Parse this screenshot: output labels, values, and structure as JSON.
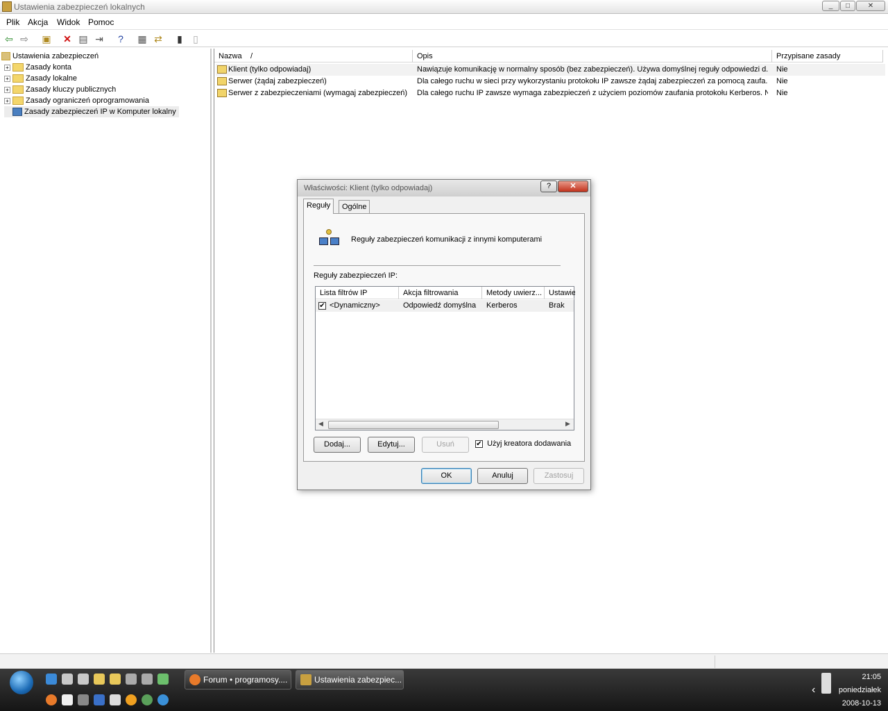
{
  "window": {
    "title": "Ustawienia zabezpieczeń lokalnych",
    "minimize": "_",
    "restore": "□",
    "close": "✕"
  },
  "menu": [
    "Plik",
    "Akcja",
    "Widok",
    "Pomoc"
  ],
  "toolbar": [
    "back-arrow-icon",
    "forward-arrow-icon",
    "up-folder-icon",
    "delete-icon",
    "properties-icon",
    "export-icon",
    "help-icon",
    "assign-icon",
    "policy-icon",
    "new-policy-icon",
    "edit-policy-icon"
  ],
  "tree": {
    "root": "Ustawienia zabezpieczeń",
    "items": [
      {
        "label": "Zasady konta",
        "expand": "+"
      },
      {
        "label": "Zasady lokalne",
        "expand": "+"
      },
      {
        "label": "Zasady kluczy publicznych",
        "expand": "+"
      },
      {
        "label": "Zasady ograniczeń oprogramowania",
        "expand": "+"
      },
      {
        "label": "Zasady zabezpieczeń IP w Komputer lokalny",
        "expand": ""
      }
    ]
  },
  "list": {
    "columns": [
      "Nazwa",
      "Opis",
      "Przypisane zasady"
    ],
    "sort_indicator": "/",
    "rows": [
      {
        "name": "Klient (tylko odpowiadaj)",
        "desc": "Nawiązuje komunikację w normalny sposób (bez zabezpieczeń). Używa domyślnej reguły odpowiedzi d...",
        "assigned": "Nie"
      },
      {
        "name": "Serwer (żądaj zabezpieczeń)",
        "desc": "Dla całego ruchu w sieci przy wykorzystaniu protokołu IP zawsze żądaj zabezpieczeń za pomocą zaufa...",
        "assigned": "Nie"
      },
      {
        "name": "Serwer z zabezpieczeniami (wymagaj zabezpieczeń)",
        "desc": "Dla całego ruchu IP zawsze wymaga zabezpieczeń z użyciem poziomów zaufania protokołu Kerberos. N...",
        "assigned": "Nie"
      }
    ]
  },
  "dialog": {
    "title": "Właściwości: Klient (tylko odpowiadaj)",
    "help": "?",
    "close": "✕",
    "tabs": [
      "Reguły",
      "Ogólne"
    ],
    "heading": "Reguły zabezpieczeń komunikacji z innymi komputerami",
    "section_label": "Reguły zabezpieczeń IP:",
    "rules_columns": [
      "Lista filtrów IP",
      "Akcja filtrowania",
      "Metody uwierz...",
      "Ustawie"
    ],
    "rules_rows": [
      {
        "checked": "✔",
        "filter": "<Dynamiczny>",
        "action": "Odpowiedź domyślna",
        "auth": "Kerberos",
        "setting": "Brak"
      }
    ],
    "buttons": {
      "add": "Dodaj...",
      "edit": "Edytuj...",
      "remove": "Usuń"
    },
    "wizard": {
      "checked": "✔",
      "label": "Użyj kreatora dodawania"
    },
    "ok": "OK",
    "cancel": "Anuluj",
    "apply": "Zastosuj"
  },
  "taskbar": {
    "tasks": [
      "Forum • programosy....",
      "Ustawienia zabezpiec..."
    ],
    "clock": {
      "time": "21:05",
      "day": "poniedziałek",
      "date": "2008-10-13"
    },
    "tray_arrow": "‹"
  }
}
